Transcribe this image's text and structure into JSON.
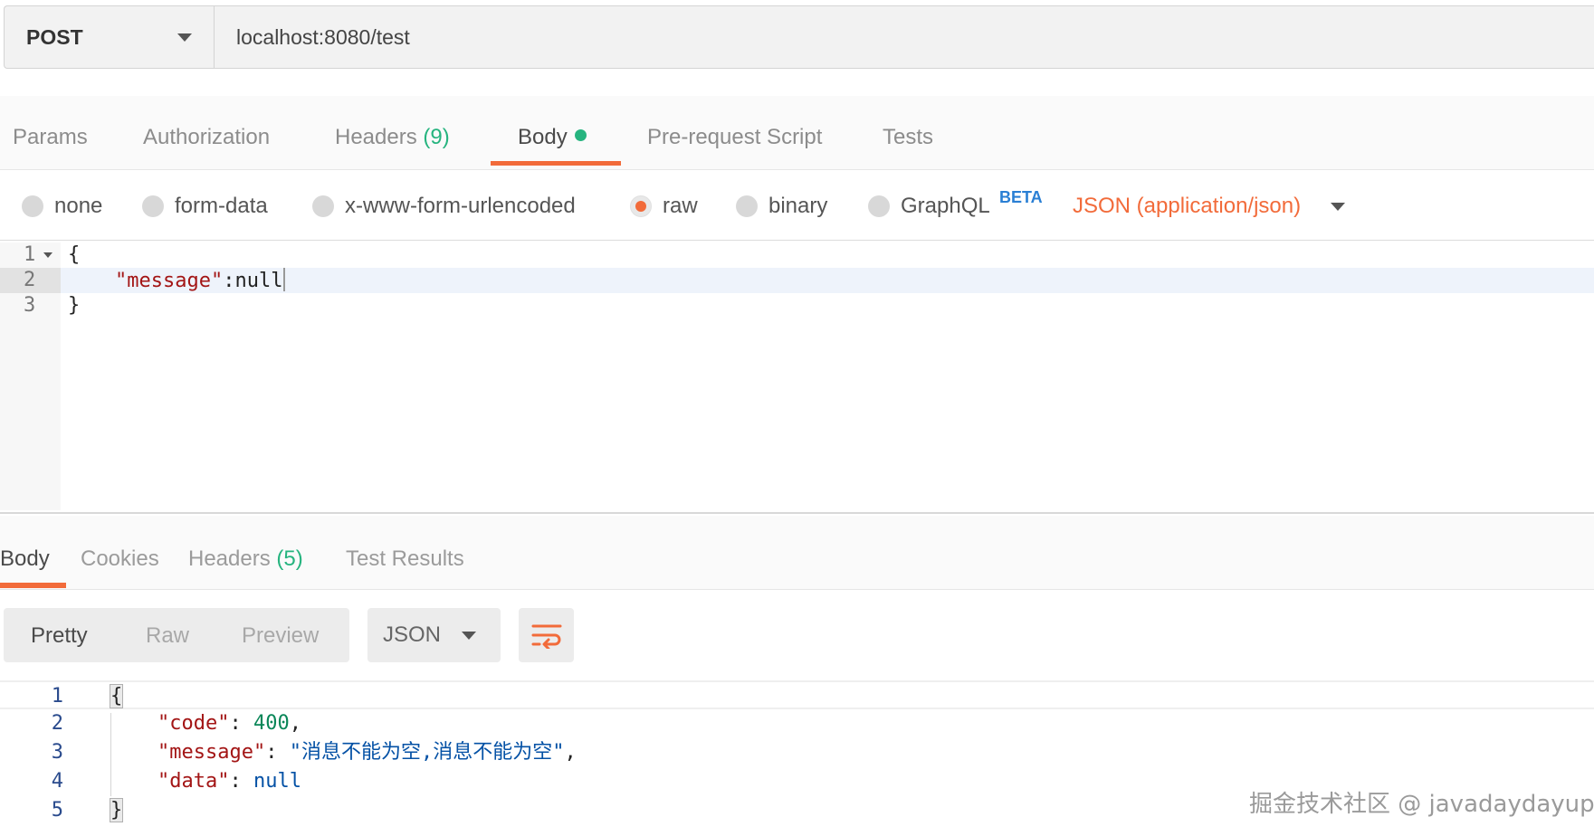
{
  "request": {
    "method": "POST",
    "url": "localhost:8080/test"
  },
  "request_tabs": [
    {
      "label": "Params"
    },
    {
      "label": "Authorization"
    },
    {
      "label": "Headers",
      "count": "(9)"
    },
    {
      "label": "Body",
      "active": true
    },
    {
      "label": "Pre-request Script"
    },
    {
      "label": "Tests"
    }
  ],
  "body_types": [
    {
      "label": "none"
    },
    {
      "label": "form-data"
    },
    {
      "label": "x-www-form-urlencoded"
    },
    {
      "label": "raw",
      "selected": true
    },
    {
      "label": "binary"
    },
    {
      "label": "GraphQL"
    }
  ],
  "graphql_badge": "BETA",
  "content_type": "JSON (application/json)",
  "request_body": {
    "lines": [
      {
        "n": "1",
        "text": "{"
      },
      {
        "n": "2",
        "key": "\"message\"",
        "rest": ":null"
      },
      {
        "n": "3",
        "text": "}"
      }
    ]
  },
  "response_tabs": [
    {
      "label": "Body",
      "active": true
    },
    {
      "label": "Cookies"
    },
    {
      "label": "Headers",
      "count": "(5)"
    },
    {
      "label": "Test Results"
    }
  ],
  "response_view": {
    "modes": [
      "Pretty",
      "Raw",
      "Preview"
    ],
    "active_mode": "Pretty",
    "format": "JSON"
  },
  "response_body": {
    "line_numbers": [
      "1",
      "2",
      "3",
      "4",
      "5"
    ],
    "open_brace": "{",
    "close_brace": "}",
    "code_key": "\"code\"",
    "code_value": "400",
    "message_key": "\"message\"",
    "message_value": "\"消息不能为空,消息不能为空\"",
    "data_key": "\"data\"",
    "data_value": "null"
  },
  "watermark": "掘金技术社区 @ javadaydayup",
  "colors": {
    "accent": "#f26b3a",
    "count_green": "#26b47f",
    "beta_blue": "#2a7fd4"
  }
}
